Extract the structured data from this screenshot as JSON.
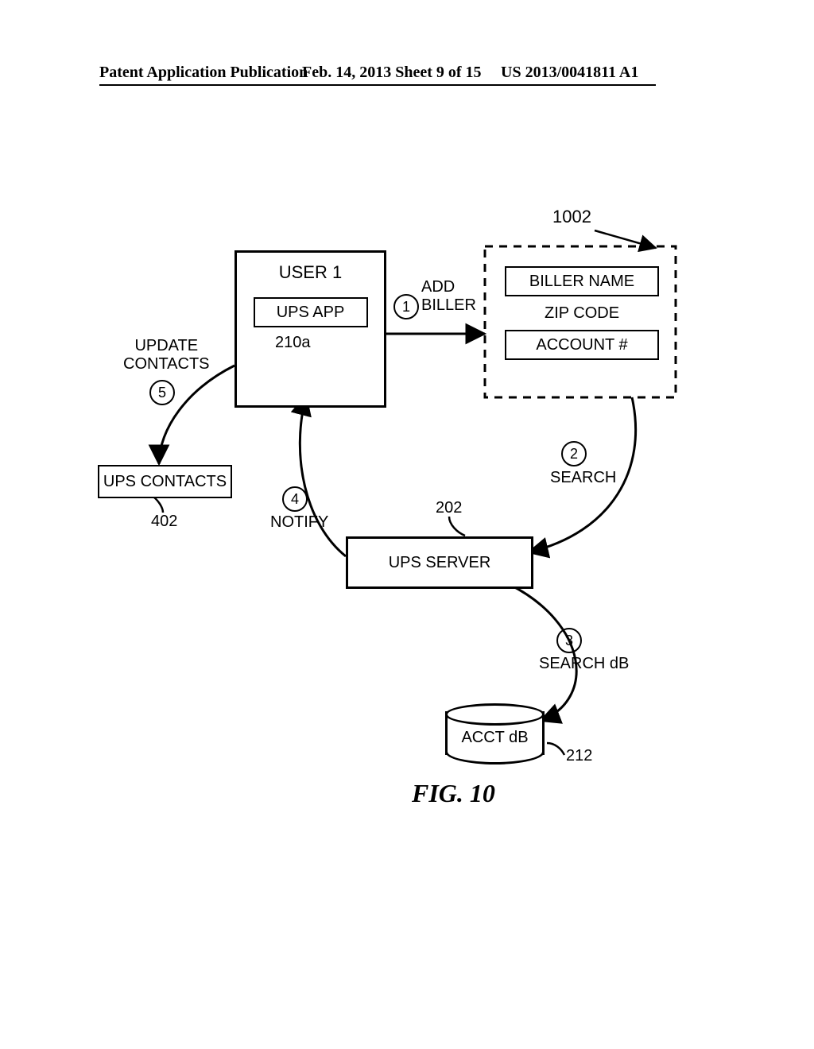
{
  "header": {
    "left": "Patent Application Publication",
    "center": "Feb. 14, 2013  Sheet 9 of 15",
    "right": "US 2013/0041811 A1"
  },
  "steps": {
    "s1": {
      "num": "1",
      "label": "ADD\nBILLER"
    },
    "s2": {
      "num": "2",
      "label": "SEARCH"
    },
    "s3": {
      "num": "3",
      "label": "SEARCH dB"
    },
    "s4": {
      "num": "4",
      "label": "NOTIFY"
    },
    "s5": {
      "num": "5",
      "label": "UPDATE\nCONTACTS"
    }
  },
  "nodes": {
    "user1": {
      "title": "USER 1",
      "app": "UPS APP",
      "ref": "210a"
    },
    "form": {
      "ref": "1002",
      "biller_name": "BILLER NAME",
      "zip": "ZIP CODE",
      "account": "ACCOUNT #"
    },
    "server": {
      "label": "UPS SERVER",
      "ref": "202"
    },
    "db": {
      "label": "ACCT dB",
      "ref": "212"
    },
    "contacts": {
      "label": "UPS CONTACTS",
      "ref": "402"
    }
  },
  "figure": "FIG. 10"
}
